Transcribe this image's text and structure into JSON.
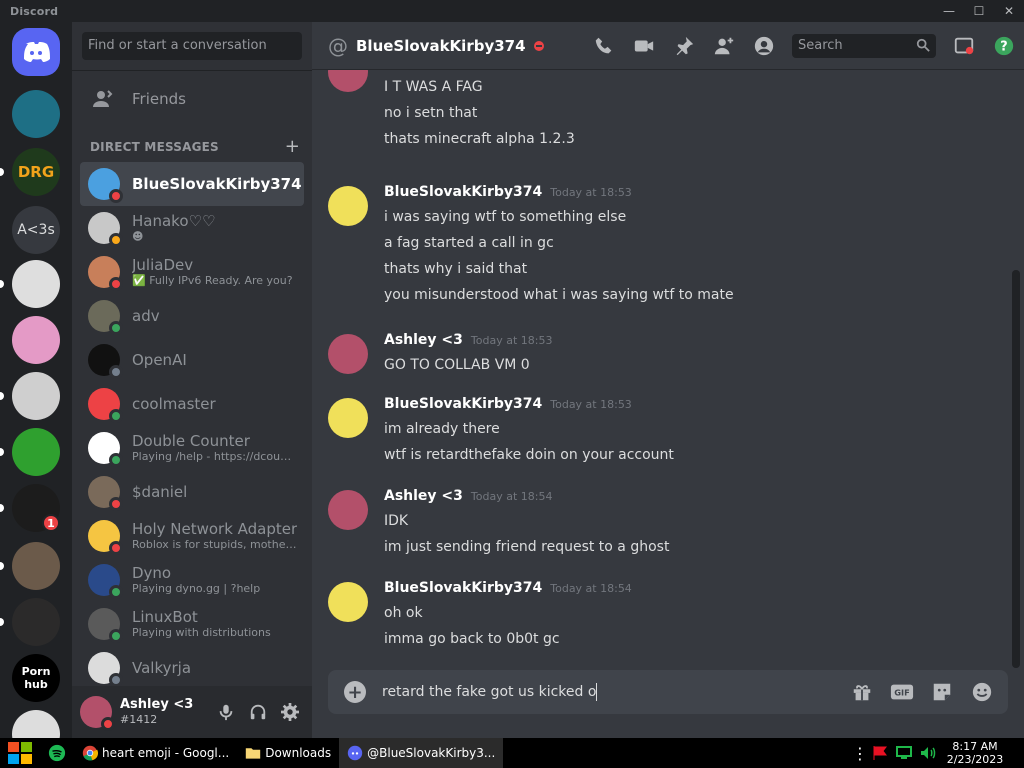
{
  "window": {
    "app_name": "Discord"
  },
  "servers": [
    {
      "label": "",
      "name": "home",
      "color": "#5865f2"
    },
    {
      "label": "",
      "name": "diamond",
      "color": "#1e6f85"
    },
    {
      "label": "DRG",
      "name": "drg",
      "color": "#1f3a1c"
    },
    {
      "label": "A<3s",
      "name": "a3s",
      "color": "#36393f"
    },
    {
      "label": "",
      "name": "troll",
      "color": "#dedede"
    },
    {
      "label": "",
      "name": "popgallery",
      "color": "#e49ac6"
    },
    {
      "label": "",
      "name": "sans",
      "color": "#cfcfcf"
    },
    {
      "label": "",
      "name": "green-troll",
      "color": "#2fa02f"
    },
    {
      "label": "",
      "name": "robot",
      "color": "#1c1c1c",
      "badge": "1"
    },
    {
      "label": "",
      "name": "dog",
      "color": "#6b5a4a"
    },
    {
      "label": "",
      "name": "ls",
      "color": "#2b2a2a"
    },
    {
      "label": "Porn hub",
      "name": "ph",
      "color": "#000000"
    },
    {
      "label": "",
      "name": "penguin",
      "color": "#dddddd"
    }
  ],
  "sidebar": {
    "search_placeholder": "Find or start a conversation",
    "friends_label": "Friends",
    "dm_header": "DIRECT MESSAGES",
    "dm_add": "+",
    "dms": [
      {
        "name": "BlueSlovakKirby374",
        "sub": "",
        "status": "dnd",
        "color": "#4ba0e0",
        "active": true
      },
      {
        "name": "Hanako♡♡",
        "sub": "☻",
        "status": "idle",
        "color": "#c8c8c8"
      },
      {
        "name": "JuliaDev",
        "sub": "✅ Fully IPv6 Ready. Are you?",
        "status": "dnd",
        "color": "#c87f5a"
      },
      {
        "name": "adv",
        "sub": "",
        "status": "online",
        "color": "#6b6a5a"
      },
      {
        "name": "OpenAI",
        "sub": "",
        "status": "offline",
        "color": "#111111"
      },
      {
        "name": "coolmaster",
        "sub": "",
        "status": "online",
        "color": "#ed4245"
      },
      {
        "name": "Double Counter",
        "sub": "Playing /help - https://dcount...",
        "status": "online",
        "color": "#ffffff"
      },
      {
        "name": "$daniel",
        "sub": "",
        "status": "dnd",
        "color": "#7a6a5a"
      },
      {
        "name": "Holy Network Adapter",
        "sub": "Roblox is for stupids, motherf...",
        "status": "dnd",
        "color": "#f5c542"
      },
      {
        "name": "Dyno",
        "sub": "Playing dyno.gg | ?help",
        "status": "online",
        "color": "#2a4a8a"
      },
      {
        "name": "LinuxBot",
        "sub": "Playing with distributions",
        "status": "online",
        "color": "#5a5a5a"
      },
      {
        "name": "Valkyrja",
        "sub": "",
        "status": "offline",
        "color": "#dcdcdc"
      }
    ]
  },
  "user": {
    "name": "Ashley <3",
    "tag": "#1412",
    "status": "dnd",
    "color": "#b3506a"
  },
  "chat": {
    "title": "BlueSlovakKirby374",
    "header_search": "Search",
    "groups": [
      {
        "author": "",
        "time": "",
        "avatar_color": "#b3506a",
        "cont": true,
        "lines": [
          "WAIT I CAN EXPLAIN",
          "I T WAS A FAG",
          "no i setn that",
          "thats minecraft alpha 1.2.3"
        ]
      },
      {
        "author": "BlueSlovakKirby374",
        "time": "Today at 18:53",
        "avatar_color": "#f0e05a",
        "lines": [
          "i was saying wtf to something else",
          "a fag started a call in gc",
          "thats why i said that",
          "you misunderstood what i was saying wtf to mate"
        ]
      },
      {
        "author": "Ashley <3",
        "time": "Today at 18:53",
        "avatar_color": "#b3506a",
        "lines": [
          "GO TO COLLAB VM 0"
        ]
      },
      {
        "author": "BlueSlovakKirby374",
        "time": "Today at 18:53",
        "avatar_color": "#f0e05a",
        "lines": [
          "im already there",
          "wtf is retardthefake doin on your account"
        ]
      },
      {
        "author": "Ashley <3",
        "time": "Today at 18:54",
        "avatar_color": "#b3506a",
        "lines": [
          "IDK",
          "im just sending friend request to a ghost"
        ]
      },
      {
        "author": "BlueSlovakKirby374",
        "time": "Today at 18:54",
        "avatar_color": "#f0e05a",
        "lines": [
          "oh ok",
          "imma go back to 0b0t gc"
        ]
      }
    ],
    "composer_value": "retard the fake got us kicked o"
  },
  "taskbar": {
    "items": [
      {
        "label": "",
        "name": "spotify"
      },
      {
        "label": "heart emoji - Googl...",
        "name": "chrome"
      },
      {
        "label": "Downloads",
        "name": "explorer"
      },
      {
        "label": "@BlueSlovakKirby3...",
        "name": "discord",
        "active": true
      }
    ],
    "time": "8:17 AM",
    "date": "2/23/2023"
  }
}
